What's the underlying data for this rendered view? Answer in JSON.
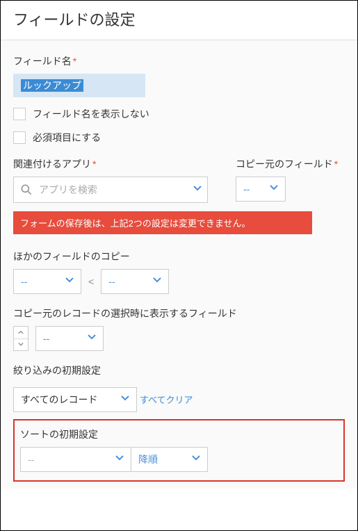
{
  "header": {
    "title": "フィールドの設定"
  },
  "fieldName": {
    "label": "フィールド名",
    "value": "ルックアップ",
    "hideLabel": "フィールド名を表示しない",
    "requiredLabel": "必須項目にする"
  },
  "relatedApp": {
    "label": "関連付けるアプリ",
    "placeholder": "アプリを検索"
  },
  "copySourceField": {
    "label": "コピー元のフィールド",
    "value": "--"
  },
  "warning": "フォームの保存後は、上記2つの設定は変更できません。",
  "otherCopy": {
    "label": "ほかのフィールドのコピー",
    "left": "--",
    "right": "--"
  },
  "displayFields": {
    "label": "コピー元のレコードの選択時に表示するフィールド",
    "value": "--"
  },
  "filter": {
    "label": "絞り込みの初期設定",
    "value": "すべてのレコード",
    "clearAll": "すべてクリア"
  },
  "sort": {
    "label": "ソートの初期設定",
    "field": "--",
    "order": "降順"
  }
}
